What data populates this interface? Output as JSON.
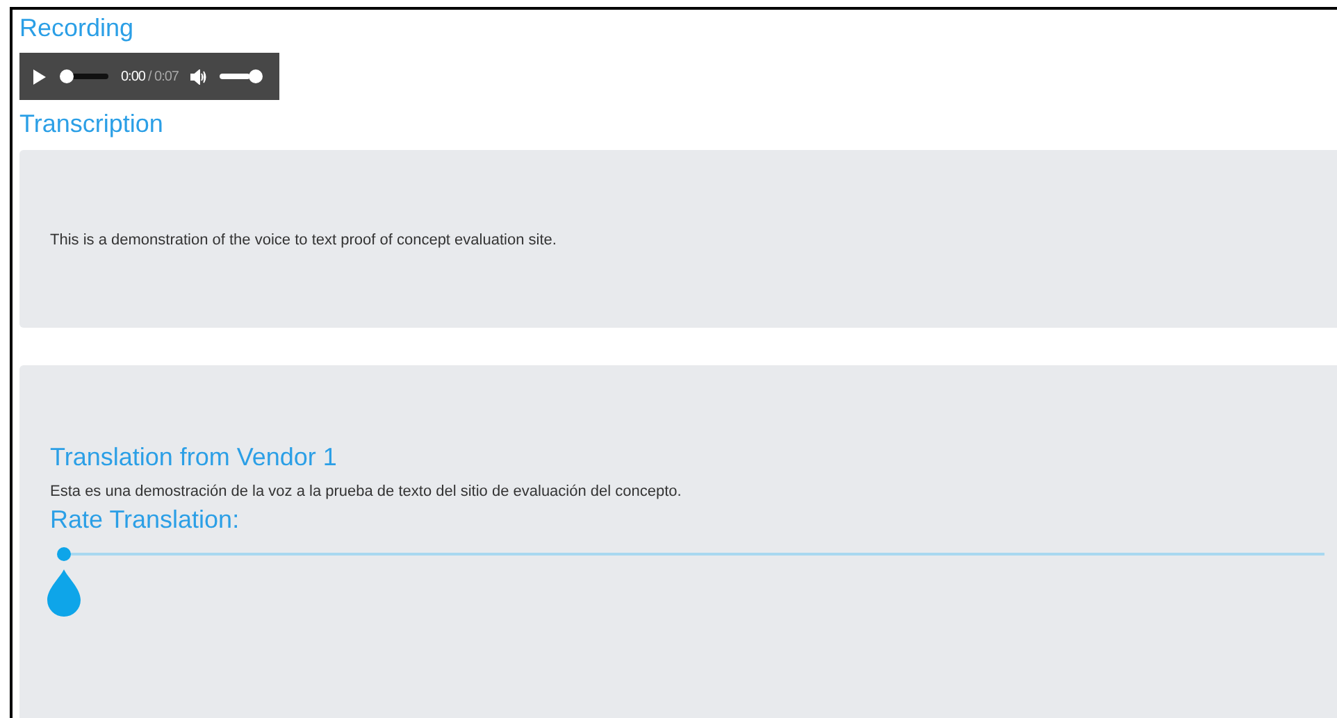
{
  "recording": {
    "title": "Recording",
    "player": {
      "current_time": "0:00",
      "duration": "/ 0:07",
      "progress": {
        "level": 0
      },
      "volume": {
        "level": 1
      }
    }
  },
  "transcription": {
    "title": "Transcription",
    "text": "This is a demonstration of the voice to text proof of concept evaluation site."
  },
  "translation": {
    "title": "Translation from Vendor 1",
    "text": "Esta es una demostración de la voz a la prueba de texto del sitio de evaluación del concepto.",
    "rating_label": "Rate Translation:",
    "rating": {
      "level": 0
    }
  }
}
